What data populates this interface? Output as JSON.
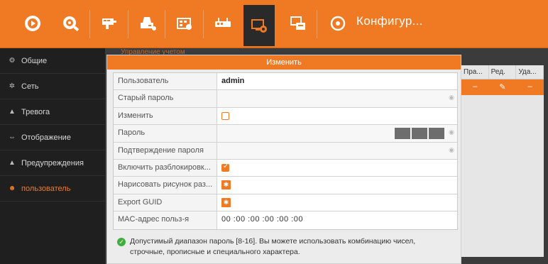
{
  "toolbar": {
    "icons": [
      "playback-icon",
      "search-camera-icon",
      "camera-settings-icon",
      "record-icon",
      "storage-icon",
      "network-device-icon",
      "system-config-icon",
      "maintenance-icon",
      "power-icon"
    ],
    "title": "Конфигур...",
    "accent": "#f07a24"
  },
  "sidebar": {
    "items": [
      {
        "label": "Общие",
        "icon": "general-icon"
      },
      {
        "label": "Сеть",
        "icon": "network-icon"
      },
      {
        "label": "Тревога",
        "icon": "alarm-icon"
      },
      {
        "label": "Отображение",
        "icon": "display-icon"
      },
      {
        "label": "Предупреждения",
        "icon": "warning-icon"
      },
      {
        "label": "пользователь",
        "icon": "user-icon"
      }
    ]
  },
  "background": {
    "section_title": "Управление учетом"
  },
  "user_table": {
    "columns": [
      "Пра...",
      "Ред.",
      "Уда..."
    ],
    "row": [
      "–",
      "✎",
      "–"
    ]
  },
  "dialog": {
    "title": "Изменить",
    "fields": [
      {
        "label": "Пользователь",
        "value": "admin"
      },
      {
        "label": "Старый пароль",
        "value": ""
      },
      {
        "label": "Изменить",
        "value": ""
      },
      {
        "label": "Пароль",
        "value": ""
      },
      {
        "label": "Подтверждение пароля",
        "value": ""
      },
      {
        "label": "Включить разблокировк...",
        "value": ""
      },
      {
        "label": "Нарисовать рисунок раз...",
        "value": ""
      },
      {
        "label": "Export GUID",
        "value": ""
      },
      {
        "label": "MAC-адрес польз-я",
        "value": "00 :00 :00 :00 :00 :00"
      }
    ],
    "note": "Допустимый диапазон пароль [8-16]. Вы можете использовать комбинацию чисел, строчные, прописные и специального характера."
  }
}
